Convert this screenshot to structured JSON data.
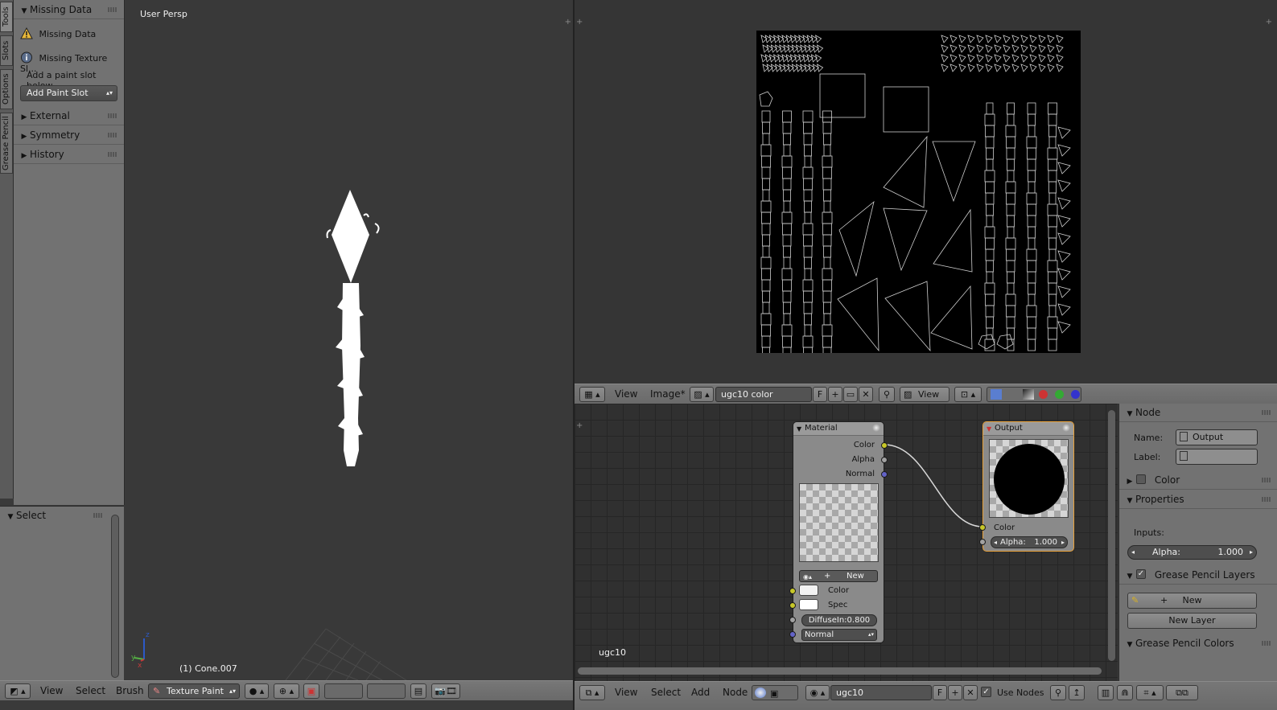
{
  "tool_tabs": [
    "Tools",
    "Slots",
    "Options",
    "Grease Pencil"
  ],
  "toolshelf": {
    "missing_data_header": "Missing Data",
    "missing_data_warning": "Missing Data",
    "missing_texture": "Missing Texture Sl...",
    "hint": "Add a paint slot below",
    "add_paint_slot": "Add Paint Slot",
    "panels": [
      "External",
      "Symmetry",
      "History"
    ]
  },
  "select_panel": {
    "title": "Select"
  },
  "viewport": {
    "label": "User Persp",
    "object_info": "(1) Cone.007",
    "header": {
      "menus": [
        "View",
        "Select",
        "Brush"
      ],
      "mode": "Texture Paint"
    }
  },
  "image_editor": {
    "header": {
      "menus": [
        "View",
        "Image*"
      ],
      "image_name": "ugc10 color",
      "fake_user": "F",
      "view_select": "View"
    }
  },
  "node_editor": {
    "tree_name": "ugc10",
    "material_node": {
      "title": "Material",
      "outputs": [
        "Color",
        "Alpha",
        "Normal"
      ],
      "new_button": "New",
      "inputs": [
        "Color",
        "Spec"
      ],
      "diffuse": "DiffuseIn:0.800",
      "normal_select": "Normal"
    },
    "output_node": {
      "title": "Output",
      "color_label": "Color",
      "alpha_label": "Alpha:",
      "alpha_value": "1.000"
    },
    "header": {
      "menus": [
        "View",
        "Select",
        "Add",
        "Node"
      ],
      "material_name": "ugc10",
      "fake_user": "F",
      "use_nodes": "Use Nodes"
    }
  },
  "npanel": {
    "node_header": "Node",
    "name_label": "Name:",
    "name_value": "Output",
    "label_label": "Label:",
    "label_value": "",
    "color_header": "Color",
    "properties_header": "Properties",
    "inputs_label": "Inputs:",
    "alpha_label": "Alpha:",
    "alpha_value": "1.000",
    "gp_layers_header": "Grease Pencil Layers",
    "gp_new": "New",
    "gp_new_layer": "New Layer",
    "gp_colors_header": "Grease Pencil Colors"
  },
  "colors": {
    "accent_orange": "#e8a13a",
    "warning_yellow": "#e8b83a",
    "socket_yellow": "#c7c729",
    "socket_blue": "#6363c7"
  }
}
